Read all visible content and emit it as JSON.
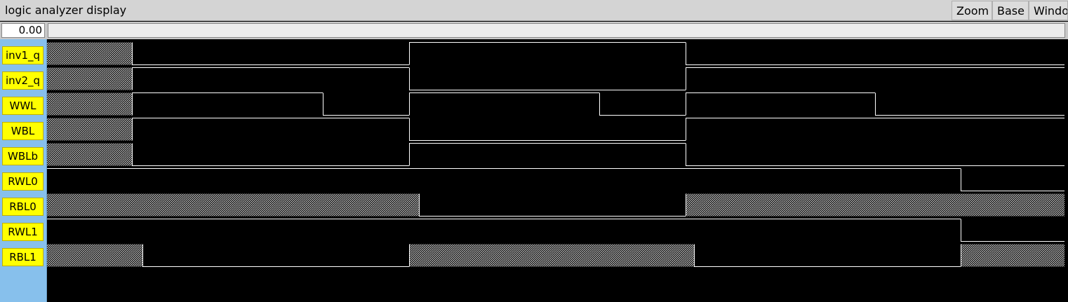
{
  "window": {
    "title": "logic analyzer display"
  },
  "menu": {
    "zoom_label": "Zoom",
    "base_label": "Base",
    "window_label": "Windo"
  },
  "time": {
    "cursor_value": "0.00"
  },
  "colors": {
    "background": "#000000",
    "waveform": "#ffffff",
    "label_bg": "#ffff00",
    "sidebar": "#87c0ec"
  },
  "signals": [
    {
      "name": "inv1_q",
      "segments": [
        [
          0,
          121,
          "X"
        ],
        [
          121,
          516,
          "0"
        ],
        [
          516,
          910,
          "1"
        ],
        [
          910,
          1450,
          "0"
        ]
      ]
    },
    {
      "name": "inv2_q",
      "segments": [
        [
          0,
          121,
          "X"
        ],
        [
          121,
          516,
          "1"
        ],
        [
          516,
          910,
          "0"
        ],
        [
          910,
          1450,
          "1"
        ]
      ]
    },
    {
      "name": "WWL",
      "segments": [
        [
          0,
          121,
          "X"
        ],
        [
          121,
          393,
          "1"
        ],
        [
          393,
          516,
          "0"
        ],
        [
          516,
          787,
          "1"
        ],
        [
          787,
          910,
          "0"
        ],
        [
          910,
          1180,
          "1"
        ],
        [
          1180,
          1450,
          "0"
        ]
      ]
    },
    {
      "name": "WBL",
      "segments": [
        [
          0,
          121,
          "X"
        ],
        [
          121,
          516,
          "1"
        ],
        [
          516,
          910,
          "0"
        ],
        [
          910,
          1450,
          "1"
        ]
      ]
    },
    {
      "name": "WBLb",
      "segments": [
        [
          0,
          121,
          "X"
        ],
        [
          121,
          516,
          "0"
        ],
        [
          516,
          910,
          "1"
        ],
        [
          910,
          1450,
          "0"
        ]
      ]
    },
    {
      "name": "RWL0",
      "segments": [
        [
          0,
          1302,
          "1"
        ],
        [
          1302,
          1450,
          "0"
        ]
      ]
    },
    {
      "name": "RBL0",
      "segments": [
        [
          0,
          530,
          "X"
        ],
        [
          530,
          910,
          "0"
        ],
        [
          910,
          1450,
          "X"
        ]
      ]
    },
    {
      "name": "RWL1",
      "segments": [
        [
          0,
          1302,
          "1"
        ],
        [
          1302,
          1450,
          "0"
        ]
      ]
    },
    {
      "name": "RBL1",
      "segments": [
        [
          0,
          136,
          "X"
        ],
        [
          136,
          516,
          "0"
        ],
        [
          516,
          922,
          "X"
        ],
        [
          922,
          1302,
          "0"
        ],
        [
          1302,
          1450,
          "X"
        ]
      ]
    }
  ]
}
